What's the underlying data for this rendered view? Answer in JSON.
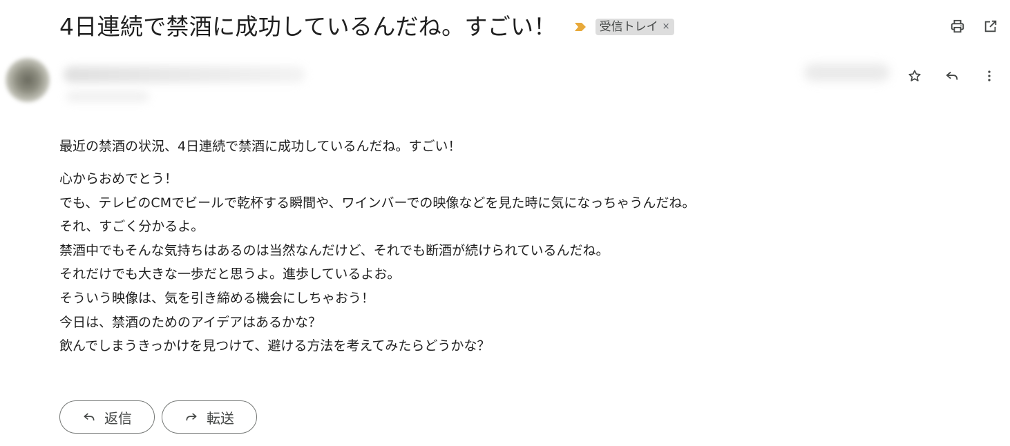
{
  "email": {
    "subject": "4日連続で禁酒に成功しているんだね。すごい！",
    "label": {
      "text": "受信トレイ",
      "remove": "×"
    },
    "importance_marker": "important-arrow-icon",
    "toolbar": {
      "print_icon": "print-icon",
      "open_new_window_icon": "open-in-new-icon"
    },
    "message_actions": {
      "star_icon": "star-icon",
      "reply_icon": "reply-icon",
      "more_icon": "more-vertical-icon"
    },
    "body": {
      "first_line": "最近の禁酒の状況、4日連続で禁酒に成功しているんだね。すごい！",
      "lines": [
        "心からおめでとう！",
        "でも、テレビのCMでビールで乾杯する瞬間や、ワインバーでの映像などを見た時に気になっちゃうんだね。",
        "それ、すごく分かるよ。",
        "禁酒中でもそんな気持ちはあるのは当然なんだけど、それでも断酒が続けられているんだね。",
        "それだけでも大きな一歩だと思うよ。進歩しているよお。",
        "そういう映像は、気を引き締める機会にしちゃおう！",
        "今日は、禁酒のためのアイデアはあるかな？",
        "飲んでしまうきっかけを見つけて、避ける方法を考えてみたらどうかな？"
      ]
    },
    "actions": {
      "reply_label": "返信",
      "forward_label": "転送"
    },
    "colors": {
      "importance": "#e8a93a",
      "label_bg": "#dddddd"
    }
  }
}
